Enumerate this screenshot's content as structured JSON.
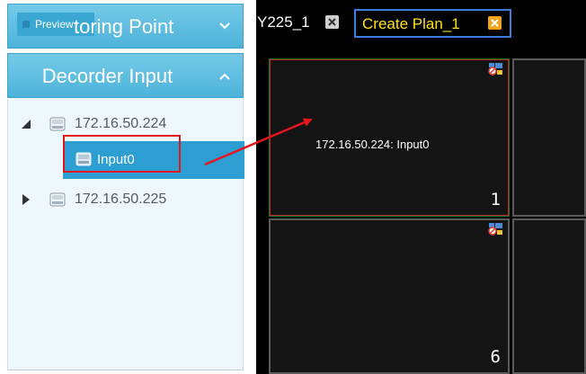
{
  "left_panel": {
    "preview_tab": "Preview",
    "monitoring_header": "toring Point",
    "decoder_header": "Decorder Input",
    "tree": {
      "host1": "172.16.50.224",
      "input0": "Input0",
      "host2": "172.16.50.225"
    }
  },
  "tabs": [
    {
      "label": "Y225_1"
    },
    {
      "label": "Create Plan_1"
    }
  ],
  "grid": {
    "cell1_source": "172.16.50.224: Input0",
    "cell1_number": "1",
    "cell6_number": "6"
  },
  "colors": {
    "header_blue": "#4db3da",
    "selection_blue": "#2c9ed2",
    "highlight_red": "#e4161d",
    "active_tab_text": "#ffe31a",
    "active_tab_border": "#3b7ddc"
  },
  "icons": {
    "monitoring_chevron": "chevron-down-icon",
    "decoder_chevron": "chevron-up-icon",
    "host_icon": "decoder-device-icon",
    "tab_close": "close-icon",
    "cell_icon": "stream-status-icon"
  }
}
